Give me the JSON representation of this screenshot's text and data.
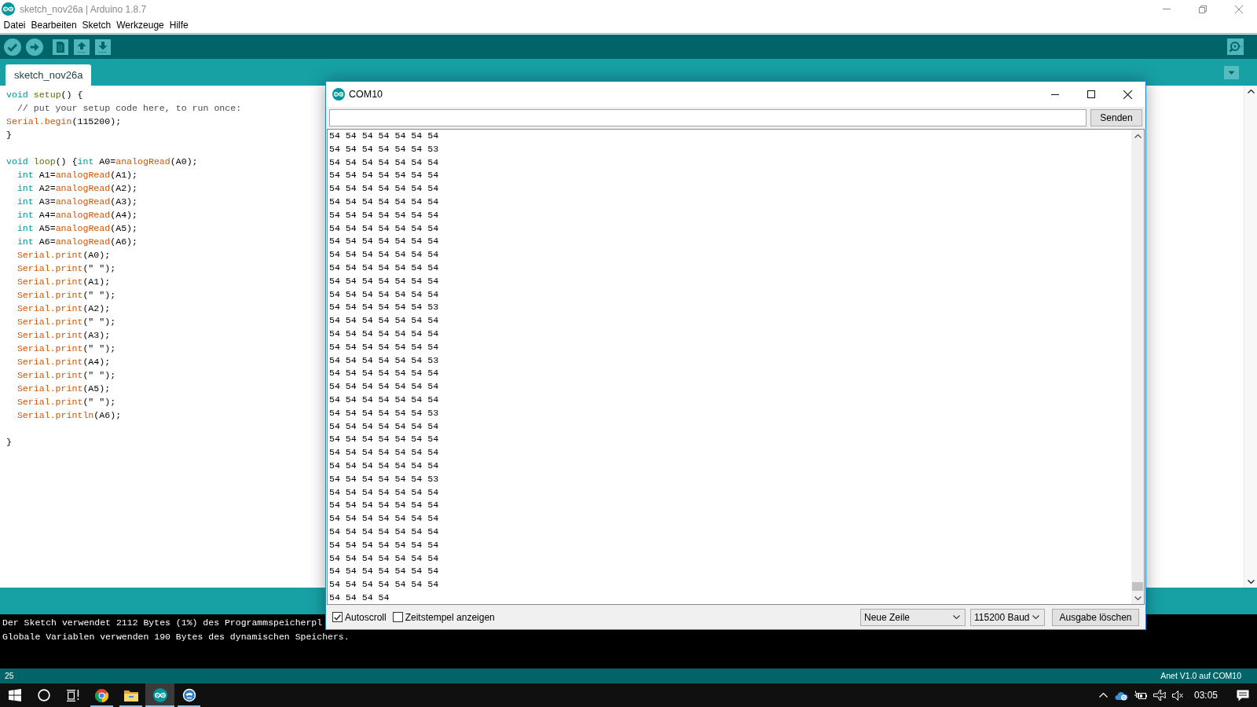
{
  "window": {
    "title": "sketch_nov26a | Arduino 1.8.7"
  },
  "menu": [
    "Datei",
    "Bearbeiten",
    "Sketch",
    "Werkzeuge",
    "Hilfe"
  ],
  "toolbar": [
    {
      "kind": "verify"
    },
    {
      "kind": "upload"
    },
    {
      "kind": "new"
    },
    {
      "kind": "open"
    },
    {
      "kind": "save"
    },
    {
      "kind": "serial_monitor"
    }
  ],
  "tabs": [
    {
      "label": "sketch_nov26a",
      "selected": true
    }
  ],
  "editor": {
    "blocks": [
      {
        "lines": [
          {
            "segments": [
              {
                "text": "void ",
                "kind": "keyword"
              },
              {
                "text": "setup",
                "kind": "function"
              },
              {
                "text": "() {",
                "kind": "plain"
              }
            ]
          },
          {
            "segments": [
              {
                "text": "  // put your setup code here, to run once:",
                "kind": "comment"
              }
            ]
          },
          {
            "segments": [
              {
                "text": "Serial.begin",
                "kind": "builtin"
              },
              {
                "text": "(115200);",
                "kind": "plain"
              }
            ]
          },
          {
            "segments": [
              {
                "text": "}",
                "kind": "plain"
              }
            ]
          }
        ]
      },
      {
        "lines": [
          {
            "segments": [
              {
                "text": "void ",
                "kind": "keyword"
              },
              {
                "text": "loop",
                "kind": "function"
              },
              {
                "text": "() {",
                "kind": "plain"
              },
              {
                "text": "int",
                "kind": "keyword"
              },
              {
                "text": " A0=",
                "kind": "plain"
              },
              {
                "text": "analogRead",
                "kind": "builtin"
              },
              {
                "text": "(A0);",
                "kind": "plain"
              }
            ]
          },
          {
            "segments": [
              {
                "text": "  int",
                "kind": "keyword"
              },
              {
                "text": " A1=",
                "kind": "plain"
              },
              {
                "text": "analogRead",
                "kind": "builtin"
              },
              {
                "text": "(A1);",
                "kind": "plain"
              }
            ]
          },
          {
            "segments": [
              {
                "text": "  int",
                "kind": "keyword"
              },
              {
                "text": " A2=",
                "kind": "plain"
              },
              {
                "text": "analogRead",
                "kind": "builtin"
              },
              {
                "text": "(A2);",
                "kind": "plain"
              }
            ]
          },
          {
            "segments": [
              {
                "text": "  int",
                "kind": "keyword"
              },
              {
                "text": " A3=",
                "kind": "plain"
              },
              {
                "text": "analogRead",
                "kind": "builtin"
              },
              {
                "text": "(A3);",
                "kind": "plain"
              }
            ]
          },
          {
            "segments": [
              {
                "text": "  int",
                "kind": "keyword"
              },
              {
                "text": " A4=",
                "kind": "plain"
              },
              {
                "text": "analogRead",
                "kind": "builtin"
              },
              {
                "text": "(A4);",
                "kind": "plain"
              }
            ]
          },
          {
            "segments": [
              {
                "text": "  int",
                "kind": "keyword"
              },
              {
                "text": " A5=",
                "kind": "plain"
              },
              {
                "text": "analogRead",
                "kind": "builtin"
              },
              {
                "text": "(A5);",
                "kind": "plain"
              }
            ]
          },
          {
            "segments": [
              {
                "text": "  int",
                "kind": "keyword"
              },
              {
                "text": " A6=",
                "kind": "plain"
              },
              {
                "text": "analogRead",
                "kind": "builtin"
              },
              {
                "text": "(A6);",
                "kind": "plain"
              }
            ]
          },
          {
            "segments": [
              {
                "text": "  Serial.print",
                "kind": "builtin"
              },
              {
                "text": "(A0);",
                "kind": "plain"
              }
            ]
          },
          {
            "segments": [
              {
                "text": "  Serial.print",
                "kind": "builtin"
              },
              {
                "text": "(\" \");",
                "kind": "plain"
              }
            ]
          },
          {
            "segments": [
              {
                "text": "  Serial.print",
                "kind": "builtin"
              },
              {
                "text": "(A1);",
                "kind": "plain"
              }
            ]
          },
          {
            "segments": [
              {
                "text": "  Serial.print",
                "kind": "builtin"
              },
              {
                "text": "(\" \");",
                "kind": "plain"
              }
            ]
          },
          {
            "segments": [
              {
                "text": "  Serial.print",
                "kind": "builtin"
              },
              {
                "text": "(A2);",
                "kind": "plain"
              }
            ]
          },
          {
            "segments": [
              {
                "text": "  Serial.print",
                "kind": "builtin"
              },
              {
                "text": "(\" \");",
                "kind": "plain"
              }
            ]
          },
          {
            "segments": [
              {
                "text": "  Serial.print",
                "kind": "builtin"
              },
              {
                "text": "(A3);",
                "kind": "plain"
              }
            ]
          },
          {
            "segments": [
              {
                "text": "  Serial.print",
                "kind": "builtin"
              },
              {
                "text": "(\" \");",
                "kind": "plain"
              }
            ]
          },
          {
            "segments": [
              {
                "text": "  Serial.print",
                "kind": "builtin"
              },
              {
                "text": "(A4);",
                "kind": "plain"
              }
            ]
          },
          {
            "segments": [
              {
                "text": "  Serial.print",
                "kind": "builtin"
              },
              {
                "text": "(\" \");",
                "kind": "plain"
              }
            ]
          },
          {
            "segments": [
              {
                "text": "  Serial.print",
                "kind": "builtin"
              },
              {
                "text": "(A5);",
                "kind": "plain"
              }
            ]
          },
          {
            "segments": [
              {
                "text": "  Serial.print",
                "kind": "builtin"
              },
              {
                "text": "(\" \");",
                "kind": "plain"
              }
            ]
          },
          {
            "segments": [
              {
                "text": "  Serial.println",
                "kind": "builtin"
              },
              {
                "text": "(A6);",
                "kind": "plain"
              }
            ]
          }
        ]
      },
      {
        "lines": [
          {
            "segments": [
              {
                "text": "}",
                "kind": "plain"
              }
            ]
          }
        ]
      }
    ]
  },
  "console": {
    "lines": [
      "Der Sketch verwendet 2112 Bytes (1%) des Programmspeicherpl",
      "Globale Variablen verwenden 190 Bytes des dynamischen Speichers."
    ]
  },
  "status_bar": {
    "line": "25",
    "board": "Anet V1.0 auf COM10"
  },
  "serial_monitor": {
    "title": "COM10",
    "send_button": "Senden",
    "output": [
      "54 54 54 54 54 54 54",
      "54 54 54 54 54 54 53",
      "54 54 54 54 54 54 54",
      "54 54 54 54 54 54 54",
      "54 54 54 54 54 54 54",
      "54 54 54 54 54 54 54",
      "54 54 54 54 54 54 54",
      "54 54 54 54 54 54 54",
      "54 54 54 54 54 54 54",
      "54 54 54 54 54 54 54",
      "54 54 54 54 54 54 54",
      "54 54 54 54 54 54 54",
      "54 54 54 54 54 54 54",
      "54 54 54 54 54 54 53",
      "54 54 54 54 54 54 54",
      "54 54 54 54 54 54 54",
      "54 54 54 54 54 54 54",
      "54 54 54 54 54 54 53",
      "54 54 54 54 54 54 54",
      "54 54 54 54 54 54 54",
      "54 54 54 54 54 54 54",
      "54 54 54 54 54 54 53",
      "54 54 54 54 54 54 54",
      "54 54 54 54 54 54 54",
      "54 54 54 54 54 54 54",
      "54 54 54 54 54 54 54",
      "54 54 54 54 54 54 53",
      "54 54 54 54 54 54 54",
      "54 54 54 54 54 54 54",
      "54 54 54 54 54 54 54",
      "54 54 54 54 54 54 54",
      "54 54 54 54 54 54 54",
      "54 54 54 54 54 54 54",
      "54 54 54 54 54 54 54",
      "54 54 54 54 54 54 54",
      "54 54 54 54"
    ],
    "options": [
      {
        "label": "Autoscroll",
        "checked": true
      },
      {
        "label": "Zeitstempel anzeigen",
        "checked": false
      }
    ],
    "line_ending": "Neue Zeile",
    "baud_rate": "115200 Baud",
    "clear_button": "Ausgabe löschen"
  },
  "taskbar": {
    "items": [
      {
        "kind": "start",
        "running": false,
        "selected": false
      },
      {
        "kind": "search",
        "running": false,
        "selected": false
      },
      {
        "kind": "task_view",
        "running": false,
        "selected": false
      },
      {
        "kind": "browser",
        "running": true,
        "selected": false
      },
      {
        "kind": "folder",
        "running": true,
        "selected": false
      },
      {
        "kind": "arduino",
        "running": true,
        "selected": true
      },
      {
        "kind": "app",
        "running": true,
        "selected": false
      }
    ],
    "clock": "03:05"
  }
}
